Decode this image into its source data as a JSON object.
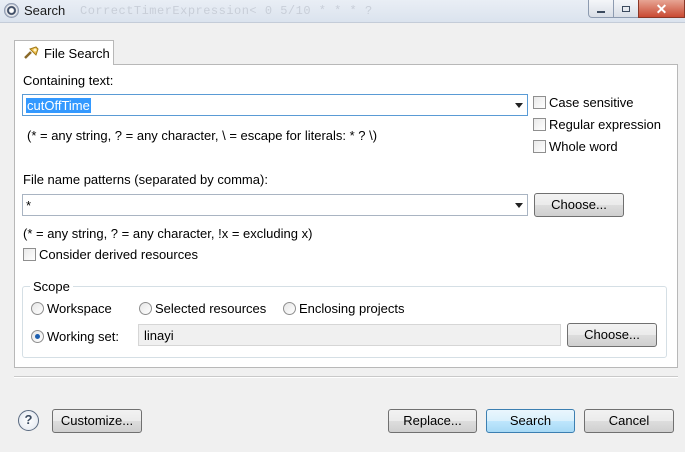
{
  "window": {
    "title": "Search",
    "title_overlay": "CorrectTimerExpression< 0 5/10 * * * ?"
  },
  "tab": {
    "label": "File Search"
  },
  "containing": {
    "label": "Containing text:",
    "value": "cutOffTime",
    "hint": "(* = any string, ? = any character, \\ = escape for literals: * ? \\)"
  },
  "options": {
    "case_sensitive": "Case sensitive",
    "regex": "Regular expression",
    "whole_word": "Whole word"
  },
  "patterns": {
    "label": "File name patterns (separated by comma):",
    "value": "*",
    "choose": "Choose...",
    "hint": "(* = any string, ? = any character, !x = excluding x)"
  },
  "derived": {
    "label": "Consider derived resources"
  },
  "scope": {
    "title": "Scope",
    "workspace": "Workspace",
    "selected_resources": "Selected resources",
    "enclosing_projects": "Enclosing projects",
    "working_set": "Working set:",
    "working_set_value": "linayi",
    "choose": "Choose...",
    "selected": "working_set"
  },
  "footer": {
    "help": "?",
    "customize": "Customize...",
    "replace": "Replace...",
    "search": "Search",
    "cancel": "Cancel"
  }
}
